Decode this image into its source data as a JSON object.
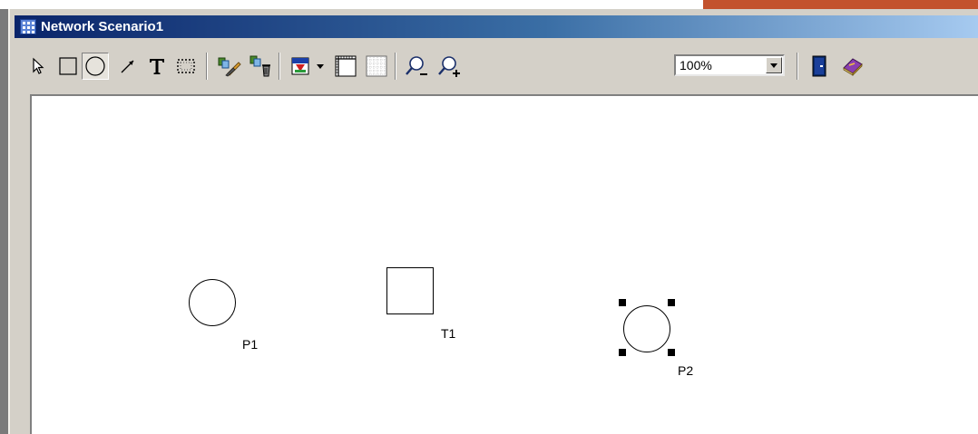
{
  "window": {
    "title": "Network Scenario1"
  },
  "toolbar": {
    "zoom_value": "100%",
    "tools": [
      "select-arrow-icon",
      "rectangle-tool-icon",
      "circle-tool-icon",
      "arc-line-tool-icon",
      "text-tool-icon",
      "dotted-rectangle-tool-icon",
      "copy-edit-icon",
      "delete-trash-icon",
      "fill-color-icon",
      "dropdown-arrow-icon",
      "ruler-grid-icon",
      "dotted-grid-icon",
      "zoom-out-icon",
      "zoom-in-icon",
      "chevron-down-icon",
      "exit-door-icon",
      "help-book-icon"
    ]
  },
  "canvas": {
    "elements": [
      {
        "kind": "place",
        "label": "P1",
        "selected": false
      },
      {
        "kind": "transition",
        "label": "T1",
        "selected": false
      },
      {
        "kind": "place",
        "label": "P2",
        "selected": true
      }
    ]
  },
  "colors": {
    "titlebar_start": "#0a246a",
    "titlebar_end": "#a6caf0",
    "toolbar_bg": "#d4d0c8",
    "accent_strip": "#c3522d"
  }
}
